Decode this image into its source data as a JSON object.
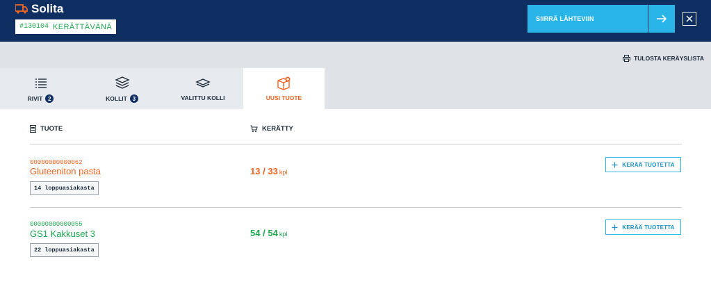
{
  "header": {
    "title": "Solita",
    "order_number": "#130104",
    "order_status": "KERÄTTÄVÄNÄ",
    "move_button_label": "SIIRRÄ LÄHTEVIIN",
    "truck_icon": "truck-icon",
    "close_icon": "close-icon"
  },
  "toolbar": {
    "print_label": "TULOSTA KERÄYSLISTA"
  },
  "tabs": [
    {
      "label": "RIVIT",
      "count": "2",
      "icon": "list-icon"
    },
    {
      "label": "KOLLIT",
      "count": "3",
      "icon": "stack-icon"
    },
    {
      "label": "VALITTU KOLLI",
      "icon": "layer-icon"
    },
    {
      "label": "UUSI TUOTE",
      "icon": "new-box-icon",
      "active": true
    }
  ],
  "table": {
    "col_product": "TUOTE",
    "col_collected": "KERÄTTY",
    "rows": [
      {
        "ean": "00000000000062",
        "name": "Gluteeniton pasta",
        "customers": "14 loppuasiakasta",
        "collected": "13",
        "separator": "/",
        "total": "33",
        "unit": "kpl",
        "button": "KERÄÄ TUOTETTA",
        "status_color": "#f26522"
      },
      {
        "ean": "00000000000055",
        "name": "GS1 Kakkuset 3",
        "customers": "22 loppuasiakasta",
        "collected": "54",
        "separator": "/",
        "total": "54",
        "unit": "kpl",
        "button": "KERÄÄ TUOTETTA",
        "status_color": "#1fa650"
      }
    ]
  },
  "colors": {
    "header_bg": "#0f2f63",
    "accent": "#29b5e8",
    "orange": "#f26522",
    "green": "#1fa650"
  }
}
